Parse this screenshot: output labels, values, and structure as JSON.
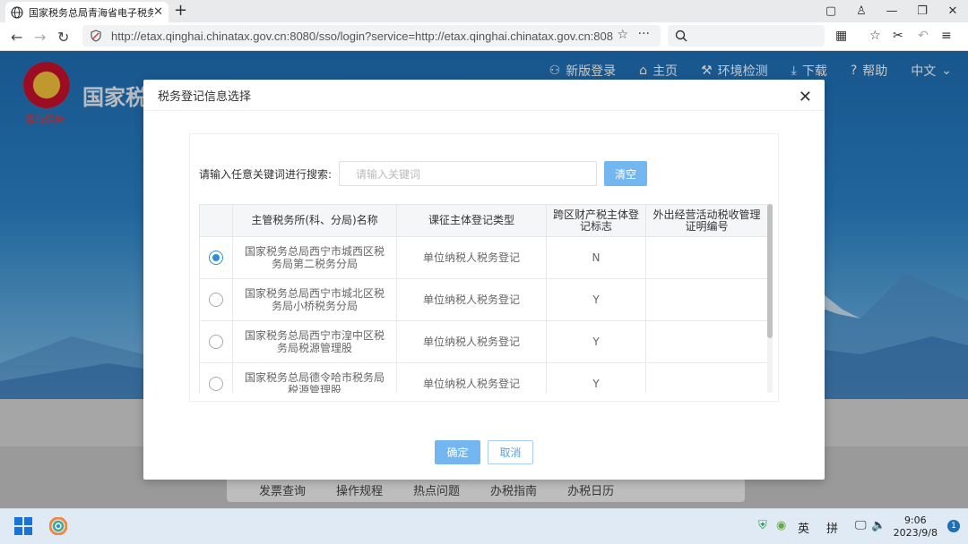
{
  "browser": {
    "tab_title": "国家税务总局青海省电子税务局",
    "url": "http://etax.qinghai.chinatax.gov.cn:8080/sso/login?service=http://etax.qinghai.chinatax.gov.cn:808(",
    "new_tab": "+",
    "tab_close": "✕"
  },
  "site": {
    "emblem_text": "青海税务",
    "brand": "国家税",
    "nav": [
      "新版登录",
      "主页",
      "环境检测",
      "下载",
      "帮助",
      "中文"
    ],
    "bottom_links": [
      "发票查询",
      "操作规程",
      "热点问题",
      "办税指南",
      "办税日历"
    ]
  },
  "modal": {
    "title": "税务登记信息选择",
    "search_label": "请输入任意关键词进行搜索:",
    "search_placeholder": "请输入关键词",
    "clear_button": "清空",
    "columns": [
      "主管税务所(科、分局)名称",
      "课征主体登记类型",
      "跨区财产税主体登记标志",
      "外出经营活动税收管理证明编号"
    ],
    "rows": [
      {
        "selected": true,
        "office": "国家税务总局西宁市城西区税务局第二税务分局",
        "type": "单位纳税人税务登记",
        "flag": "N",
        "cert": ""
      },
      {
        "selected": false,
        "office": "国家税务总局西宁市城北区税务局小桥税务分局",
        "type": "单位纳税人税务登记",
        "flag": "Y",
        "cert": ""
      },
      {
        "selected": false,
        "office": "国家税务总局西宁市湟中区税务局税源管理股",
        "type": "单位纳税人税务登记",
        "flag": "Y",
        "cert": ""
      },
      {
        "selected": false,
        "office": "国家税务总局德令哈市税务局税源管理股",
        "type": "单位纳税人税务登记",
        "flag": "Y",
        "cert": ""
      }
    ],
    "ok_button": "确定",
    "cancel_button": "取消"
  },
  "taskbar": {
    "ime_lang": "英",
    "ime_mode": "拼",
    "time": "9:06",
    "date": "2023/9/8",
    "notification_count": "1"
  },
  "colors": {
    "accent": "#74b7f0",
    "radio_selected": "#2b8fe0",
    "hero_blue": "#1f6fb6"
  }
}
